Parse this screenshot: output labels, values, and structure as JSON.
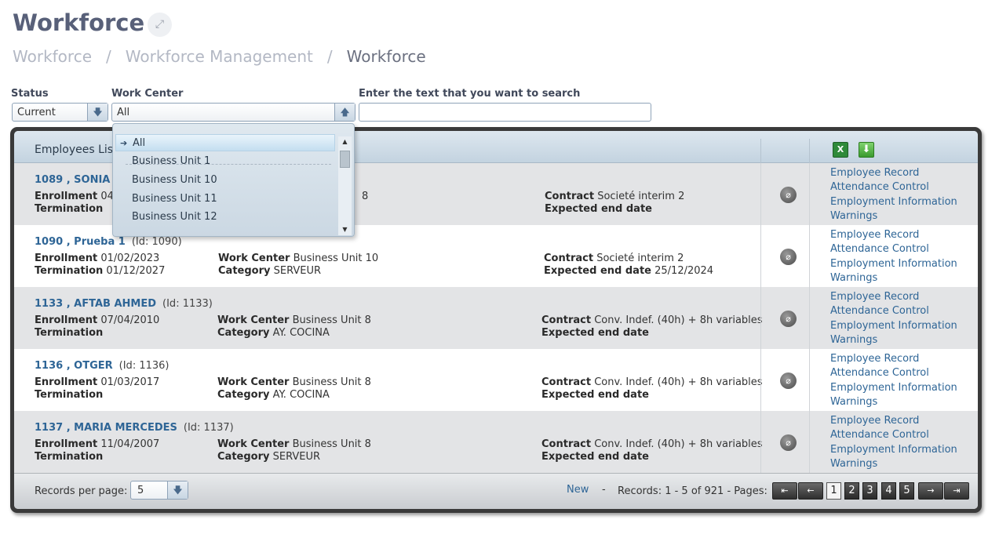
{
  "page": {
    "title": "Workforce",
    "expand_icon": "expand-icon"
  },
  "breadcrumb": {
    "items": [
      "Workforce",
      "Workforce Management",
      "Workforce"
    ],
    "separator": "/"
  },
  "filters": {
    "status_label": "Status",
    "status_value": "Current",
    "work_center_label": "Work Center",
    "work_center_value": "All",
    "search_label": "Enter the text that you want to search",
    "search_value": ""
  },
  "dropdown": {
    "options": [
      "All",
      "Business Unit 1",
      "Business Unit 10",
      "Business Unit 11",
      "Business Unit 12"
    ],
    "selected_index": 0
  },
  "list": {
    "title": "Employees List",
    "header_icons": [
      "excel-icon",
      "download-icon"
    ],
    "labels": {
      "enrollment": "Enrollment",
      "termination": "Termination",
      "work_center": "Work Center",
      "category": "Category",
      "contract": "Contract",
      "expected_end": "Expected end date"
    },
    "actions": [
      "Employee Record",
      "Attendance Control",
      "Employment Information",
      "Warnings"
    ],
    "rows": [
      {
        "name": "1089 , SONIA",
        "id": "",
        "enrollment": "04",
        "termination": "",
        "work_center": "8",
        "category": "",
        "contract": "Societé interim 2",
        "expected_end": ""
      },
      {
        "name": "1090 , Prueba 1",
        "id": "(Id: 1090)",
        "enrollment": "01/02/2023",
        "termination": "01/12/2027",
        "work_center": "Business Unit 10",
        "category": "SERVEUR",
        "contract": "Societé interim 2",
        "expected_end": "25/12/2024"
      },
      {
        "name": "1133 , AFTAB AHMED",
        "id": "(Id: 1133)",
        "enrollment": "07/04/2010",
        "termination": "",
        "work_center": "Business Unit 8",
        "category": "AY. COCINA",
        "contract": "Conv. Indef. (40h) + 8h variables",
        "expected_end": ""
      },
      {
        "name": "1136 , OTGER",
        "id": "(Id: 1136)",
        "enrollment": "01/03/2017",
        "termination": "",
        "work_center": "Business Unit 8",
        "category": "AY. COCINA",
        "contract": "Conv. Indef. (40h) + 8h variables",
        "expected_end": ""
      },
      {
        "name": "1137 , MARIA MERCEDES",
        "id": "(Id: 1137)",
        "enrollment": "11/04/2007",
        "termination": "",
        "work_center": "Business Unit 8",
        "category": "SERVEUR",
        "contract": "Conv. Indef. (40h) + 8h variables",
        "expected_end": ""
      }
    ]
  },
  "footer": {
    "records_per_page_label": "Records per page:",
    "records_per_page_value": "5",
    "new_label": "New",
    "dash": "-",
    "records_text": "Records: 1 - 5 of 921 - Pages:",
    "pages": [
      "1",
      "2",
      "3",
      "4",
      "5"
    ],
    "current_page": "1"
  }
}
